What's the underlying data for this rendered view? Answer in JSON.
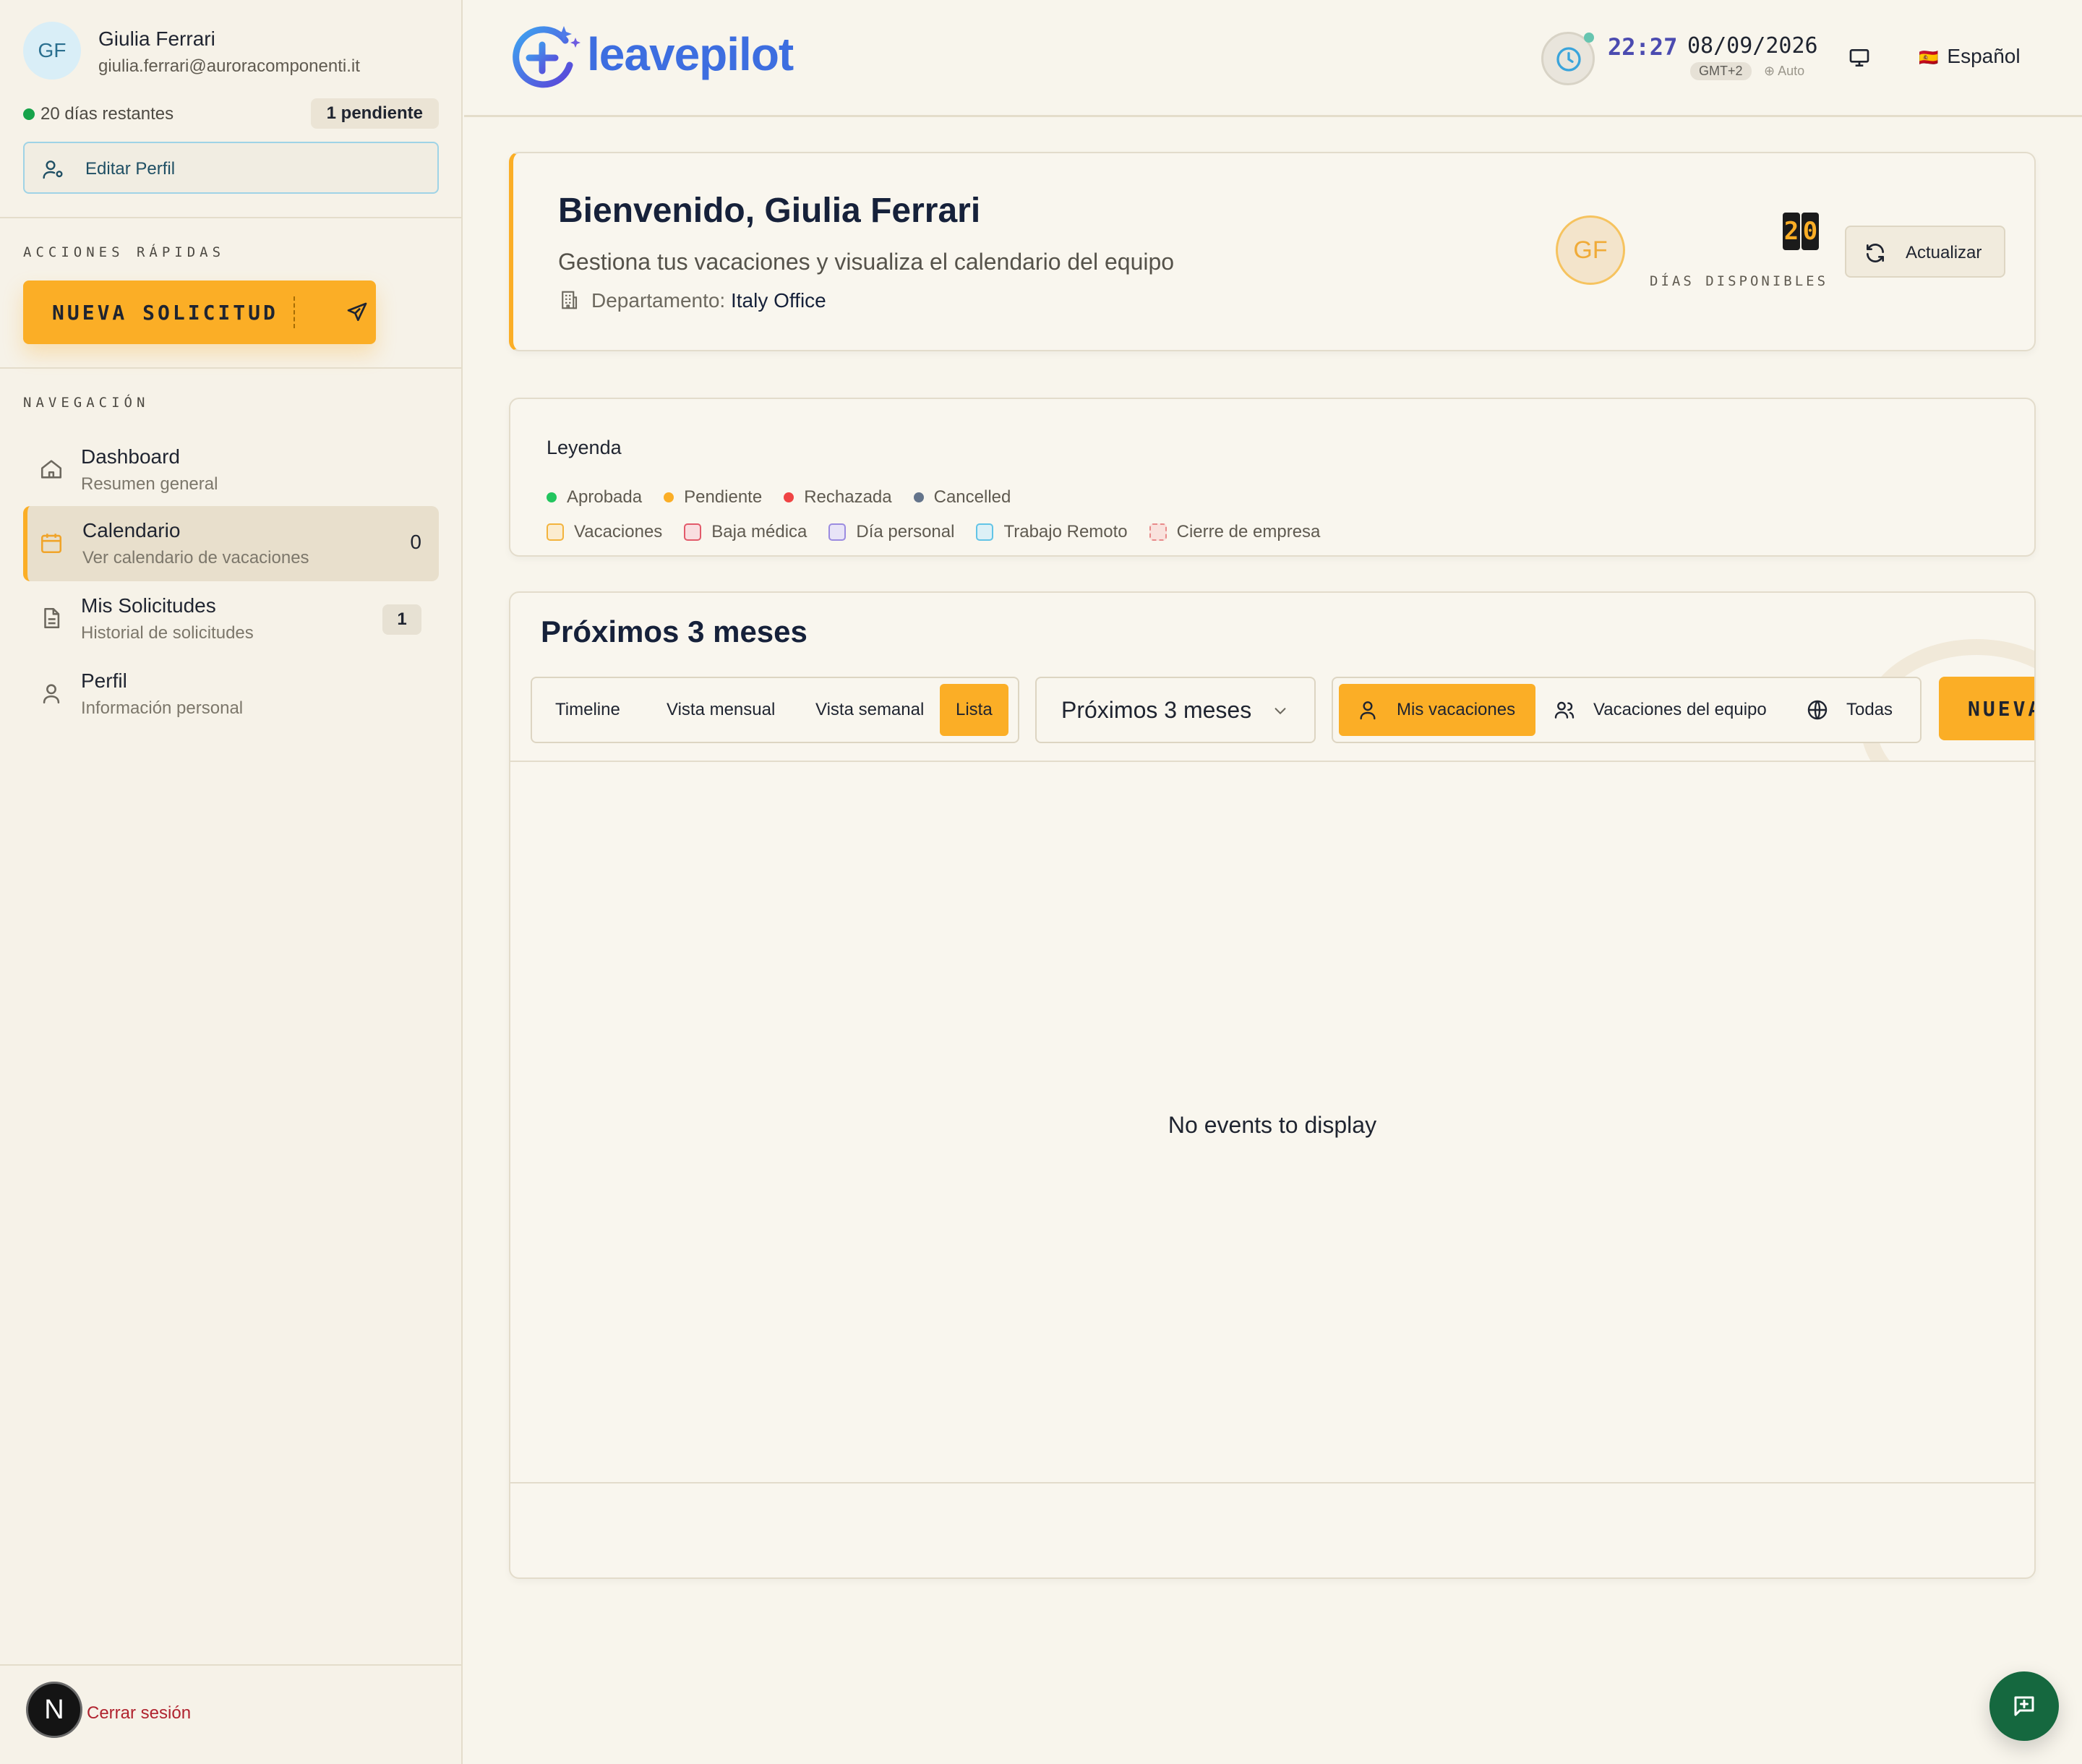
{
  "user": {
    "initials": "GF",
    "name": "Giulia Ferrari",
    "email": "giulia.ferrari@auroracomponenti.it",
    "days_left": "20 días restantes",
    "pending": "1 pendiente",
    "edit_profile": "Editar Perfil"
  },
  "sidebar": {
    "quick_actions_title": "ACCIONES RÁPIDAS",
    "new_request": "NUEVA SOLICITUD",
    "nav_title": "NAVEGACIÓN",
    "items": [
      {
        "title": "Dashboard",
        "subtitle": "Resumen general",
        "icon": "home-icon"
      },
      {
        "title": "Calendario",
        "subtitle": "Ver calendario de vacaciones",
        "count": "0",
        "icon": "calendar-icon"
      },
      {
        "title": "Mis Solicitudes",
        "subtitle": "Historial de solicitudes",
        "count": "1",
        "icon": "document-icon"
      },
      {
        "title": "Perfil",
        "subtitle": "Información personal",
        "icon": "user-icon"
      }
    ],
    "logout_initial": "N",
    "logout": "Cerrar sesión"
  },
  "header": {
    "logo_text": "leavepilot",
    "time": "22:27",
    "date": "08/09/2026",
    "timezone": "GMT+2",
    "tz_mode": "Auto",
    "language": "Español",
    "language_flag": "🇪🇸"
  },
  "welcome": {
    "title": "Bienvenido, Giulia Ferrari",
    "subtitle": "Gestiona tus vacaciones y visualiza el calendario del equipo",
    "dept_label": "Departamento:",
    "dept_value": "Italy Office",
    "avatar_initials": "GF",
    "days_digit_1": "2",
    "days_digit_2": "0",
    "days_available_label": "DÍAS DISPONIBLES",
    "refresh": "Actualizar"
  },
  "legend": {
    "title": "Leyenda",
    "statuses": [
      {
        "label": "Aprobada",
        "color": "#22c55e"
      },
      {
        "label": "Pendiente",
        "color": "#fbae26"
      },
      {
        "label": "Rechazada",
        "color": "#ef4444"
      },
      {
        "label": "Cancelled",
        "color": "#64748b"
      }
    ],
    "types": [
      {
        "label": "Vacaciones",
        "color": "#f3b33d"
      },
      {
        "label": "Baja médica",
        "color": "#e25a6a"
      },
      {
        "label": "Día personal",
        "color": "#9b8be0"
      },
      {
        "label": "Trabajo Remoto",
        "color": "#62c4e6"
      },
      {
        "label": "Cierre de empresa",
        "color": "#e88a8a"
      }
    ]
  },
  "calendar": {
    "title": "Próximos 3 meses",
    "views": [
      "Timeline",
      "Vista mensual",
      "Vista semanal",
      "Lista"
    ],
    "active_view": "Lista",
    "range": "Próximos 3 meses",
    "filters": [
      "Mis vacaciones",
      "Vacaciones del equipo",
      "Todas"
    ],
    "active_filter": "Mis vacaciones",
    "new_button_visible": "NUEVA",
    "empty": "No events to display"
  },
  "colors": {
    "accent": "#fbae26",
    "background": "#f8f5ec",
    "logo_blue": "#3d6ee0",
    "fab": "#15683f"
  }
}
